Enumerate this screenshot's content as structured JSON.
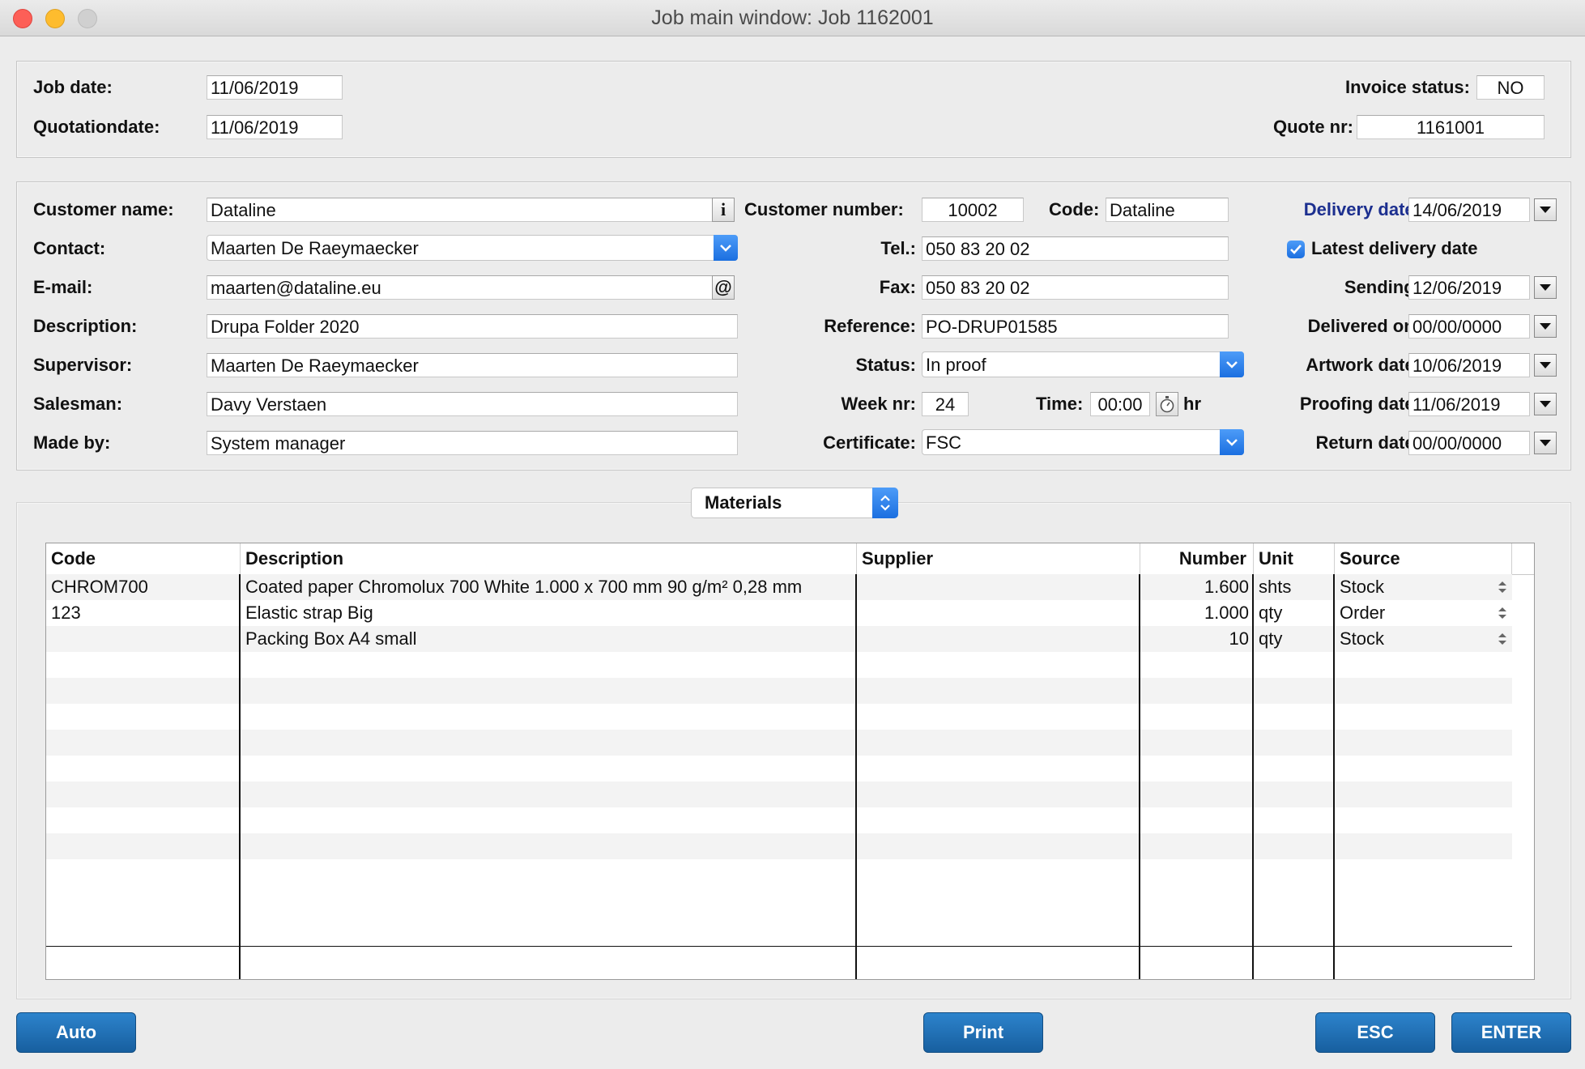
{
  "window": {
    "title": "Job main window: Job 1162001"
  },
  "header": {
    "job_date_label": "Job date:",
    "job_date": "11/06/2019",
    "quotation_date_label": "Quotationdate:",
    "quotation_date": "11/06/2019",
    "invoice_status_label": "Invoice status:",
    "invoice_status": "NO",
    "quote_nr_label": "Quote nr:",
    "quote_nr": "1161001"
  },
  "details": {
    "customer_name_label": "Customer name:",
    "customer_name": "Dataline",
    "contact_label": "Contact:",
    "contact": "Maarten De Raeymaecker",
    "email_label": "E-mail:",
    "email": "maarten@dataline.eu",
    "description_label": "Description:",
    "description": "Drupa Folder 2020",
    "supervisor_label": "Supervisor:",
    "supervisor": "Maarten De Raeymaecker",
    "salesman_label": "Salesman:",
    "salesman": "Davy Verstaen",
    "made_by_label": "Made by:",
    "made_by": "System manager",
    "customer_number_label": "Customer number:",
    "customer_number": "10002",
    "code_label": "Code:",
    "code": "Dataline",
    "tel_label": "Tel.:",
    "tel": "050 83 20 02",
    "fax_label": "Fax:",
    "fax": "050 83 20 02",
    "reference_label": "Reference:",
    "reference": "PO-DRUP01585",
    "status_label": "Status:",
    "status": "In proof",
    "week_nr_label": "Week nr:",
    "week_nr": "24",
    "time_label": "Time:",
    "time": "00:00",
    "time_unit": "hr",
    "certificate_label": "Certificate:",
    "certificate": "FSC",
    "info_button": "i",
    "email_button": "@"
  },
  "dates": {
    "delivery_date_label": "Delivery date:",
    "delivery_date": "14/06/2019",
    "latest_delivery_label": "Latest delivery date",
    "latest_delivery_checked": true,
    "sending_label": "Sending:",
    "sending": "12/06/2019",
    "delivered_on_label": "Delivered on:",
    "delivered_on": "00/00/0000",
    "artwork_date_label": "Artwork date:",
    "artwork_date": "10/06/2019",
    "proofing_date_label": "Proofing date:",
    "proofing_date": "11/06/2019",
    "return_date_label": "Return date:",
    "return_date": "00/00/0000"
  },
  "materials": {
    "tab_selector": "Materials",
    "columns": [
      "Code",
      "Description",
      "Supplier",
      "Number",
      "Unit",
      "Source"
    ],
    "rows": [
      {
        "code": "CHROM700",
        "description": "Coated paper Chromolux 700 White 1.000 x 700 mm 90 g/m² 0,28 mm",
        "supplier": "",
        "number": "1.600",
        "unit": "shts",
        "source": "Stock"
      },
      {
        "code": "123",
        "description": "Elastic strap Big",
        "supplier": "",
        "number": "1.000",
        "unit": "qty",
        "source": "Order"
      },
      {
        "code": "",
        "description": "Packing Box A4 small",
        "supplier": "",
        "number": "10",
        "unit": "qty",
        "source": "Stock"
      }
    ]
  },
  "footer": {
    "auto": "Auto",
    "print": "Print",
    "esc": "ESC",
    "enter": "ENTER"
  }
}
